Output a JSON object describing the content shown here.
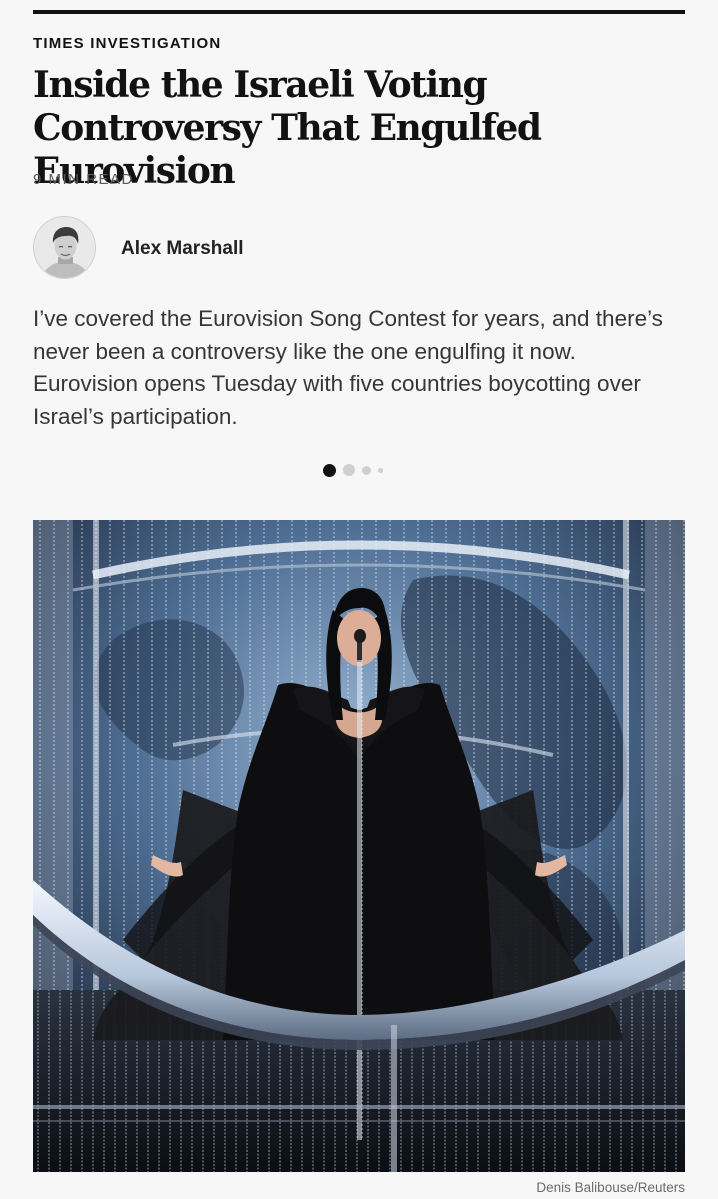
{
  "article": {
    "kicker": "TIMES INVESTIGATION",
    "headline": "Inside the Israeli Voting Controversy That Engulfed Eurovision",
    "read_time": "9 MIN READ",
    "author": "Alex Marshall",
    "summary": "I’ve covered the Eurovision Song Contest for years, and there’s never been a controversy like the one engulfing it now. Eurovision opens Tuesday with five countries boycotting over Israel’s participation.",
    "photo_credit": "Denis Balibouse/Reuters"
  },
  "carousel": {
    "count": 4,
    "active_index": 0
  },
  "colors": {
    "text": "#121212",
    "muted": "#5a5a5a",
    "background": "#f7f7f7"
  }
}
